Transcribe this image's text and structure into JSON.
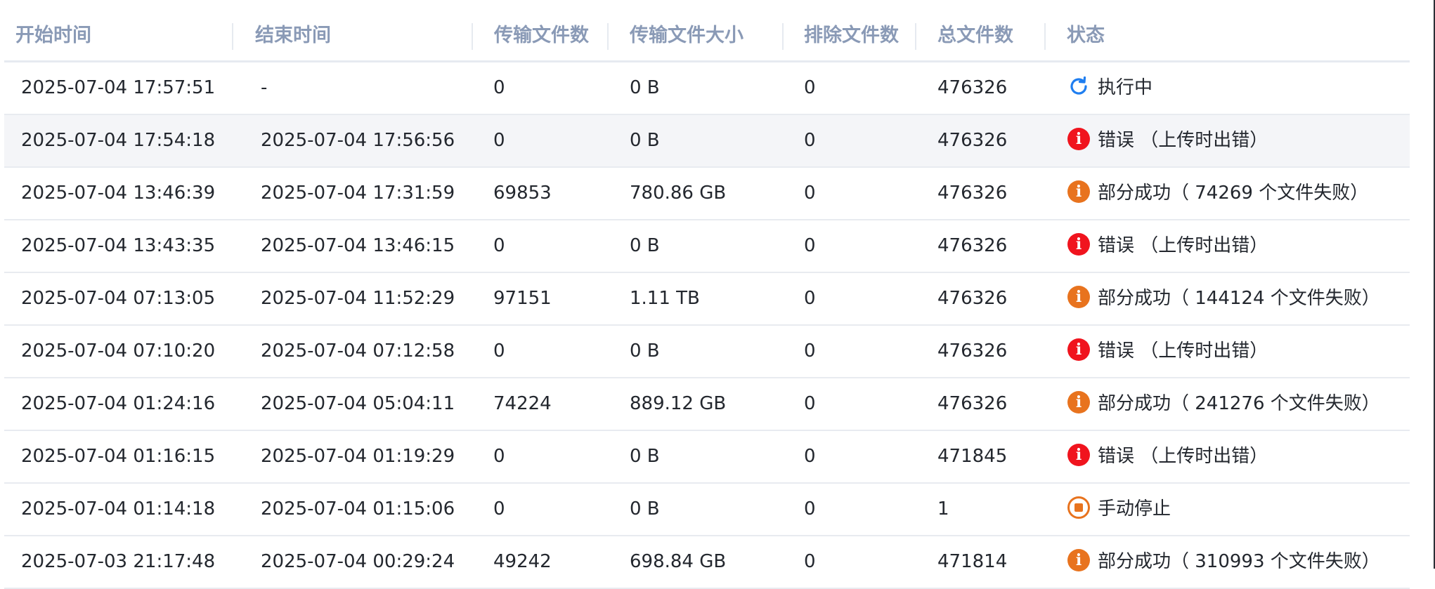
{
  "columns": {
    "start_time": "开始时间",
    "end_time": "结束时间",
    "transfer_files": "传输文件数",
    "transfer_size": "传输文件大小",
    "excluded_files": "排除文件数",
    "total_files": "总文件数",
    "status": "状态"
  },
  "colors": {
    "header_text": "#8a9ab6",
    "error": "#f0141e",
    "partial": "#e8731e",
    "running": "#1f7ef0",
    "row_highlight": "#f4f5f8"
  },
  "rows": [
    {
      "start": "2025-07-04 17:57:51",
      "end": "-",
      "files": "0",
      "size": "0 B",
      "excluded": "0",
      "total": "476326",
      "status_type": "running",
      "status_icon": "spinner-icon",
      "status_text": "执行中"
    },
    {
      "start": "2025-07-04 17:54:18",
      "end": "2025-07-04 17:56:56",
      "files": "0",
      "size": "0 B",
      "excluded": "0",
      "total": "476326",
      "status_type": "error",
      "status_icon": "error-icon",
      "status_text": "错误 （上传时出错）"
    },
    {
      "start": "2025-07-04 13:46:39",
      "end": "2025-07-04 17:31:59",
      "files": "69853",
      "size": "780.86 GB",
      "excluded": "0",
      "total": "476326",
      "status_type": "partial",
      "status_icon": "warning-icon",
      "status_text": "部分成功（ 74269 个文件失败）"
    },
    {
      "start": "2025-07-04 13:43:35",
      "end": "2025-07-04 13:46:15",
      "files": "0",
      "size": "0 B",
      "excluded": "0",
      "total": "476326",
      "status_type": "error",
      "status_icon": "error-icon",
      "status_text": "错误 （上传时出错）"
    },
    {
      "start": "2025-07-04 07:13:05",
      "end": "2025-07-04 11:52:29",
      "files": "97151",
      "size": "1.11 TB",
      "excluded": "0",
      "total": "476326",
      "status_type": "partial",
      "status_icon": "warning-icon",
      "status_text": "部分成功（ 144124 个文件失败）"
    },
    {
      "start": "2025-07-04 07:10:20",
      "end": "2025-07-04 07:12:58",
      "files": "0",
      "size": "0 B",
      "excluded": "0",
      "total": "476326",
      "status_type": "error",
      "status_icon": "error-icon",
      "status_text": "错误 （上传时出错）"
    },
    {
      "start": "2025-07-04 01:24:16",
      "end": "2025-07-04 05:04:11",
      "files": "74224",
      "size": "889.12 GB",
      "excluded": "0",
      "total": "476326",
      "status_type": "partial",
      "status_icon": "warning-icon",
      "status_text": "部分成功（ 241276 个文件失败）"
    },
    {
      "start": "2025-07-04 01:16:15",
      "end": "2025-07-04 01:19:29",
      "files": "0",
      "size": "0 B",
      "excluded": "0",
      "total": "471845",
      "status_type": "error",
      "status_icon": "error-icon",
      "status_text": "错误 （上传时出错）"
    },
    {
      "start": "2025-07-04 01:14:18",
      "end": "2025-07-04 01:15:06",
      "files": "0",
      "size": "0 B",
      "excluded": "0",
      "total": "1",
      "status_type": "stopped",
      "status_icon": "stop-icon",
      "status_text": "手动停止"
    },
    {
      "start": "2025-07-03 21:17:48",
      "end": "2025-07-04 00:29:24",
      "files": "49242",
      "size": "698.84 GB",
      "excluded": "0",
      "total": "471814",
      "status_type": "partial",
      "status_icon": "warning-icon",
      "status_text": "部分成功（ 310993 个文件失败）"
    }
  ]
}
